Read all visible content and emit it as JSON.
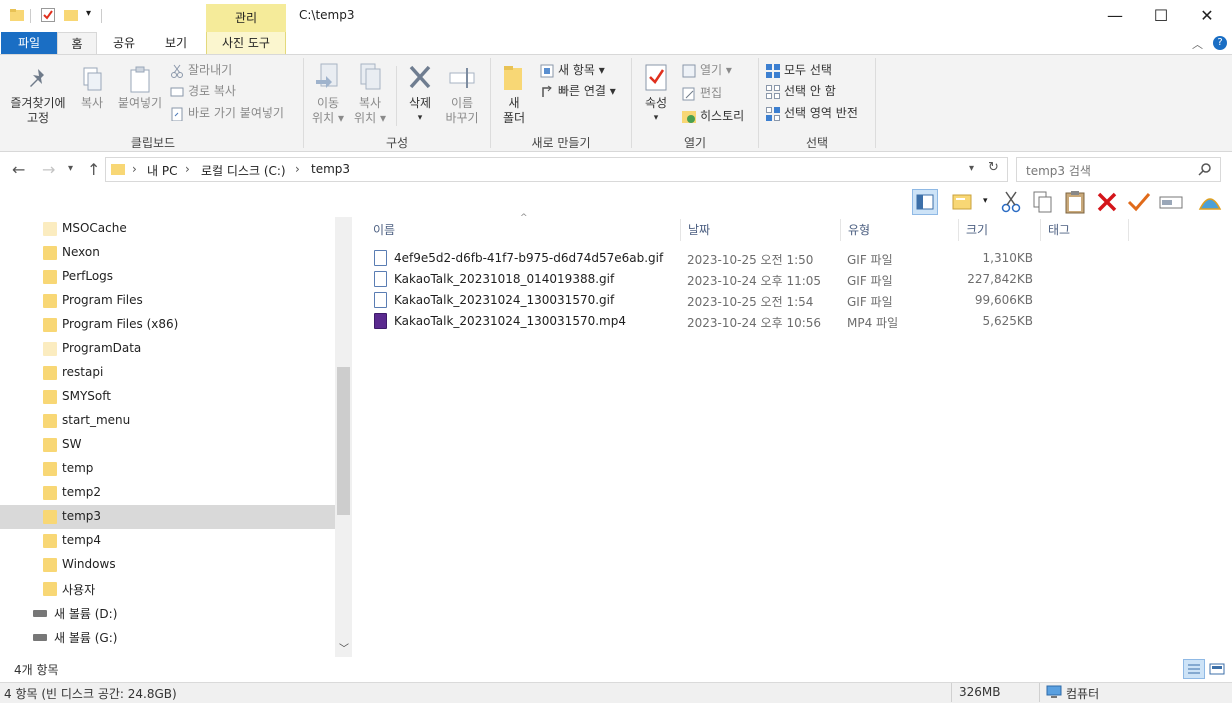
{
  "window": {
    "title": "C:\\temp3",
    "context_tab": "관리",
    "minimize_glyph": "—",
    "maximize_glyph": "☐",
    "close_glyph": "✕"
  },
  "ribbon_tabs": {
    "file": "파일",
    "home": "홈",
    "share": "공유",
    "view": "보기",
    "picture_tools": "사진 도구"
  },
  "ribbon": {
    "clipboard": {
      "label": "클립보드",
      "pin_line1": "즐겨찾기에",
      "pin_line2": "고정",
      "copy": "복사",
      "paste": "붙여넣기",
      "cut": "잘라내기",
      "copy_path": "경로 복사",
      "paste_shortcut": "바로 가기 붙여넣기"
    },
    "organize": {
      "label": "구성",
      "move_line1": "이동",
      "move_line2": "위치",
      "copy_line1": "복사",
      "copy_line2": "위치",
      "delete": "삭제",
      "rename_line1": "이름",
      "rename_line2": "바꾸기"
    },
    "new": {
      "label": "새로 만들기",
      "new_folder_line1": "새",
      "new_folder_line2": "폴더",
      "new_item": "새 항목",
      "easy_access": "빠른 연결"
    },
    "open": {
      "label": "열기",
      "properties": "속성",
      "open": "열기",
      "edit": "편집",
      "history": "히스토리"
    },
    "select": {
      "label": "선택",
      "select_all": "모두 선택",
      "select_none": "선택 안 함",
      "invert": "선택 영역 반전"
    }
  },
  "address": {
    "crumbs": [
      "내 PC",
      "로컬 디스크 (C:)",
      "temp3"
    ],
    "search_placeholder": "temp3 검색"
  },
  "nav_items": [
    {
      "label": "MSOCache",
      "type": "folder",
      "selected": false
    },
    {
      "label": "Nexon",
      "type": "folder",
      "selected": false
    },
    {
      "label": "PerfLogs",
      "type": "folder",
      "selected": false
    },
    {
      "label": "Program Files",
      "type": "folder",
      "selected": false
    },
    {
      "label": "Program Files (x86)",
      "type": "folder",
      "selected": false
    },
    {
      "label": "ProgramData",
      "type": "folder",
      "selected": false
    },
    {
      "label": "restapi",
      "type": "folder",
      "selected": false
    },
    {
      "label": "SMYSoft",
      "type": "folder",
      "selected": false
    },
    {
      "label": "start_menu",
      "type": "folder",
      "selected": false
    },
    {
      "label": "SW",
      "type": "folder",
      "selected": false
    },
    {
      "label": "temp",
      "type": "folder",
      "selected": false
    },
    {
      "label": "temp2",
      "type": "folder",
      "selected": false
    },
    {
      "label": "temp3",
      "type": "folder",
      "selected": true
    },
    {
      "label": "temp4",
      "type": "folder",
      "selected": false
    },
    {
      "label": "Windows",
      "type": "folder",
      "selected": false
    },
    {
      "label": "사용자",
      "type": "folder",
      "selected": false
    },
    {
      "label": "새 볼륨 (D:)",
      "type": "drive",
      "selected": false
    },
    {
      "label": "새 볼륨 (G:)",
      "type": "drive",
      "selected": false
    }
  ],
  "columns": {
    "name": "이름",
    "date": "날짜",
    "type": "유형",
    "size": "크기",
    "tags": "태그"
  },
  "files": [
    {
      "name": "4ef9e5d2-d6fb-41f7-b975-d6d74d57e6ab.gif",
      "date": "2023-10-25 오전 1:50",
      "type": "GIF 파일",
      "size": "1,310KB",
      "kind": "gif"
    },
    {
      "name": "KakaoTalk_20231018_014019388.gif",
      "date": "2023-10-24 오후 11:05",
      "type": "GIF 파일",
      "size": "227,842KB",
      "kind": "gif"
    },
    {
      "name": "KakaoTalk_20231024_130031570.gif",
      "date": "2023-10-25 오전 1:54",
      "type": "GIF 파일",
      "size": "99,606KB",
      "kind": "gif"
    },
    {
      "name": "KakaoTalk_20231024_130031570.mp4",
      "date": "2023-10-24 오후 10:56",
      "type": "MP4 파일",
      "size": "5,625KB",
      "kind": "mp4"
    }
  ],
  "status": {
    "item_count": "4개 항목",
    "bottom_left": "4 항목 (빈 디스크 공간: 24.8GB)",
    "size": "326MB",
    "computer": "컴퓨터"
  },
  "colors": {
    "accent": "#1a6ec4",
    "context_tab": "#f5eb9a",
    "folder": "#f8d775",
    "selected": "#d9d9d9"
  }
}
